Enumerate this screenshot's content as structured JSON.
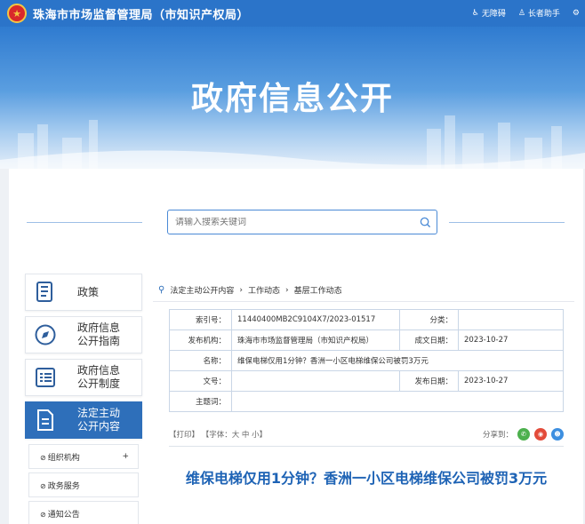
{
  "header": {
    "site_title": "珠海市市场监督管理局（市知识产权局）",
    "tools": [
      "无障碍",
      "长者助手"
    ]
  },
  "banner": {
    "title": "政府信息公开"
  },
  "search": {
    "placeholder": "请输入搜索关键词"
  },
  "nav": {
    "items": [
      {
        "label_line1": "政策",
        "label_line2": "",
        "icon": "policy-document-icon"
      },
      {
        "label_line1": "政府信息",
        "label_line2": "公开指南",
        "icon": "compass-icon"
      },
      {
        "label_line1": "政府信息",
        "label_line2": "公开制度",
        "icon": "list-document-icon"
      },
      {
        "label_line1": "法定主动",
        "label_line2": "公开内容",
        "icon": "file-icon",
        "active": true
      }
    ],
    "sub_items": [
      {
        "label": "组织机构",
        "has_plus": true
      },
      {
        "label": "政务服务",
        "has_plus": false
      },
      {
        "label": "通知公告",
        "has_plus": false
      }
    ],
    "plus": "+"
  },
  "breadcrumb": [
    "法定主动公开内容",
    "工作动态",
    "基层工作动态"
  ],
  "meta": {
    "index_label": "索引号：",
    "index_value": "11440400MB2C9104X7/2023-01517",
    "category_label": "分类：",
    "category_value": "",
    "org_label": "发布机构：",
    "org_value": "珠海市市场监督管理局（市知识产权局）",
    "created_label": "成文日期：",
    "created_value": "2023-10-27",
    "name_label": "名称：",
    "name_value": "维保电梯仅用1分钟？香洲一小区电梯维保公司被罚3万元",
    "docno_label": "文号：",
    "docno_value": "",
    "published_label": "发布日期：",
    "published_value": "2023-10-27",
    "keywords_label": "主题词：",
    "keywords_value": ""
  },
  "actions": {
    "print": "【打印】",
    "font": "【字体：大 中 小】",
    "share_label": "分享到："
  },
  "article": {
    "title": "维保电梯仅用1分钟？香洲一小区电梯维保公司被罚3万元"
  },
  "colors": {
    "primary": "#2e6fba",
    "header": "#2b74c9",
    "title_blue": "#1e63b5"
  }
}
